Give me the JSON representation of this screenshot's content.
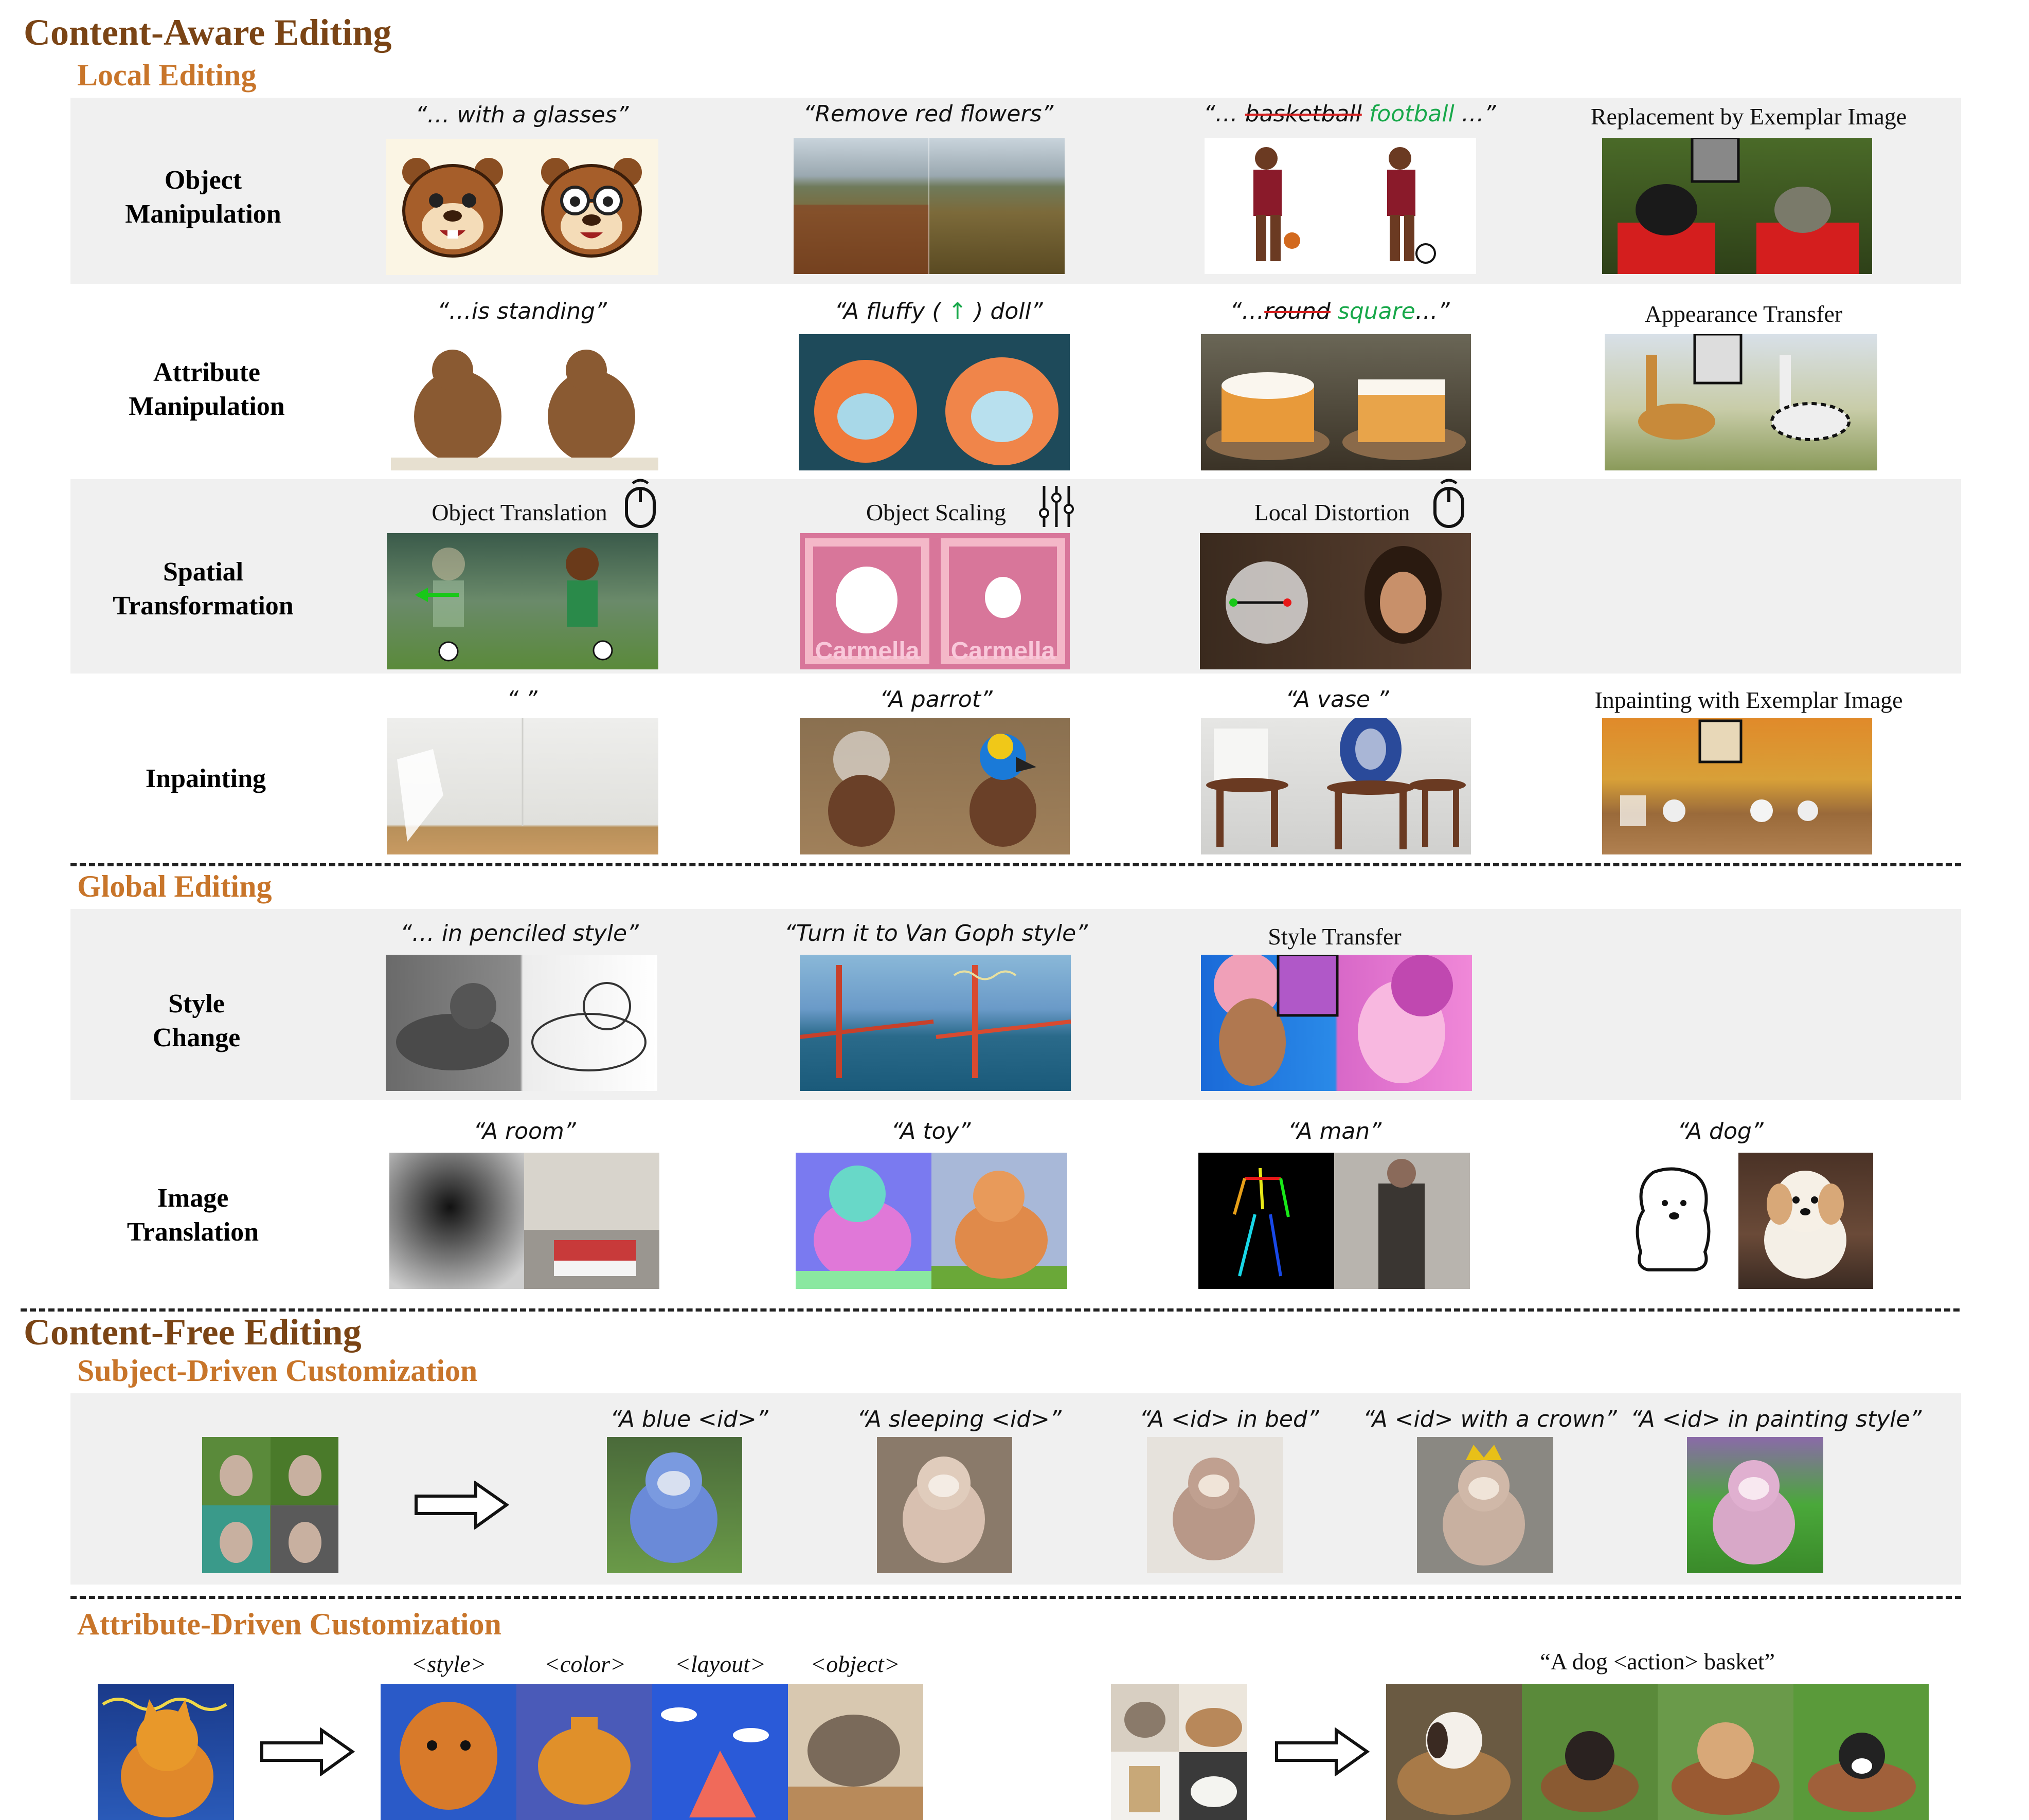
{
  "headings": {
    "content_aware": "Content-Aware Editing",
    "local": "Local Editing",
    "global": "Global Editing",
    "content_free": "Content-Free Editing",
    "subject": "Subject-Driven Customization",
    "attribute": "Attribute-Driven Customization"
  },
  "rows": {
    "object_manipulation": {
      "label": "Object\nManipulation",
      "cap1": "“… with a glasses”",
      "cap2": "“Remove red flowers”",
      "cap3": {
        "pre": "“… ",
        "struck": "basketball",
        "mid": " ",
        "green": "football",
        "post": " …”"
      },
      "cap4": "Replacement by Exemplar Image"
    },
    "attribute_manipulation": {
      "label": "Attribute\nManipulation",
      "cap1": "“…is standing”",
      "cap2": {
        "pre": "“A fluffy ( ",
        "green": "↑",
        "post": " ) doll”"
      },
      "cap3": {
        "pre": "“…",
        "struck": "round",
        "mid": " ",
        "green": "square",
        "post": "…”"
      },
      "cap4": "Appearance Transfer"
    },
    "spatial_transformation": {
      "label": "Spatial\nTransformation",
      "cap1": "Object Translation",
      "cap2": "Object Scaling",
      "cap3": "Local Distortion"
    },
    "inpainting": {
      "label": "Inpainting",
      "cap1": "“ ”",
      "cap2": "“A parrot”",
      "cap3": "“A vase ”",
      "cap4": "Inpainting with Exemplar Image"
    },
    "style_change": {
      "label": "Style\nChange",
      "cap1": "“… in penciled style”",
      "cap2": "“Turn it to Van Goph style”",
      "cap3": "Style Transfer"
    },
    "image_translation": {
      "label": "Image\nTranslation",
      "cap1": "“A room”",
      "cap2": "“A toy”",
      "cap3": "“A man”",
      "cap4": "“A dog”"
    }
  },
  "subject_captions": [
    "“A blue <id>”",
    "“A sleeping <id>”",
    "“A <id> in bed”",
    "“A <id> with a crown”",
    "“A <id> in painting style”"
  ],
  "attribute_tags": [
    "<style>",
    "<color>",
    "<layout>",
    "<object>"
  ],
  "attribute_caption": "“A dog <action> basket”",
  "colors": {
    "heading_dark": "#7a4415",
    "heading_orange": "#c8752a",
    "band": "#f0f0f0",
    "highlight_green": "#18a84a",
    "strike_red": "#d62020"
  },
  "icons": [
    "mouse-icon",
    "sliders-icon",
    "right-arrow-icon"
  ]
}
